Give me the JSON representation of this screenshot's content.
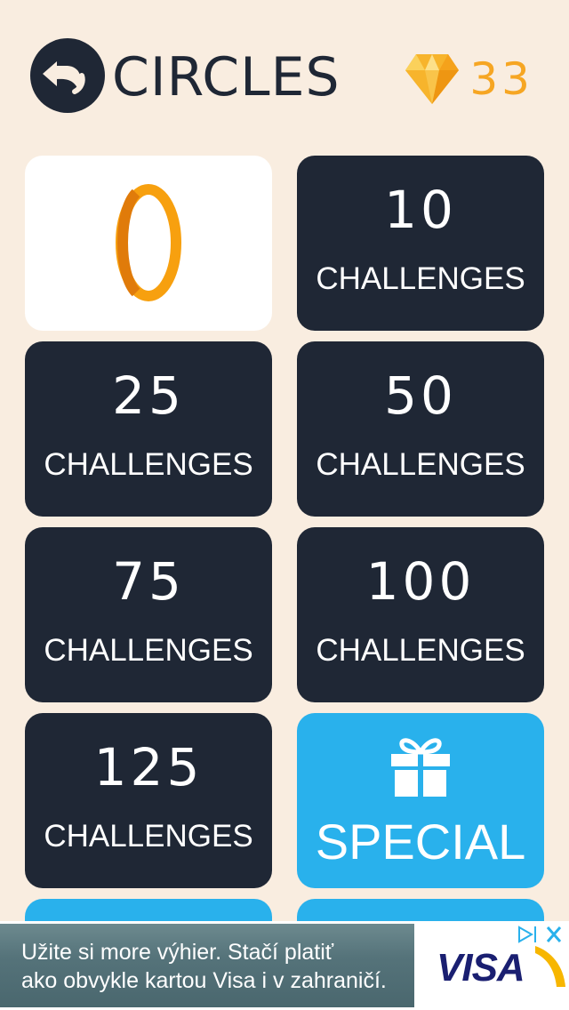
{
  "header": {
    "title": "CIRCLES",
    "gem_count": "33",
    "back_icon": "back-arrow-icon",
    "gem_icon": "diamond-icon"
  },
  "tiles": [
    {
      "value": "0",
      "state": "current"
    },
    {
      "value": "10",
      "label": "CHALLENGES"
    },
    {
      "value": "25",
      "label": "CHALLENGES"
    },
    {
      "value": "50",
      "label": "CHALLENGES"
    },
    {
      "value": "75",
      "label": "CHALLENGES"
    },
    {
      "value": "100",
      "label": "CHALLENGES"
    },
    {
      "value": "125",
      "label": "CHALLENGES"
    },
    {
      "label": "SPECIAL",
      "icon": "gift-icon"
    }
  ],
  "ad": {
    "line1": "Užite si more výhier. Stačí platiť",
    "line2": "ako obvykle kartou Visa i v zahraničí.",
    "brand": "VISA"
  },
  "colors": {
    "background": "#f9ede0",
    "tile_dark": "#1f2735",
    "tile_special": "#29b1ec",
    "gem": "#f6a623",
    "current_ring": "#f59d0b"
  }
}
